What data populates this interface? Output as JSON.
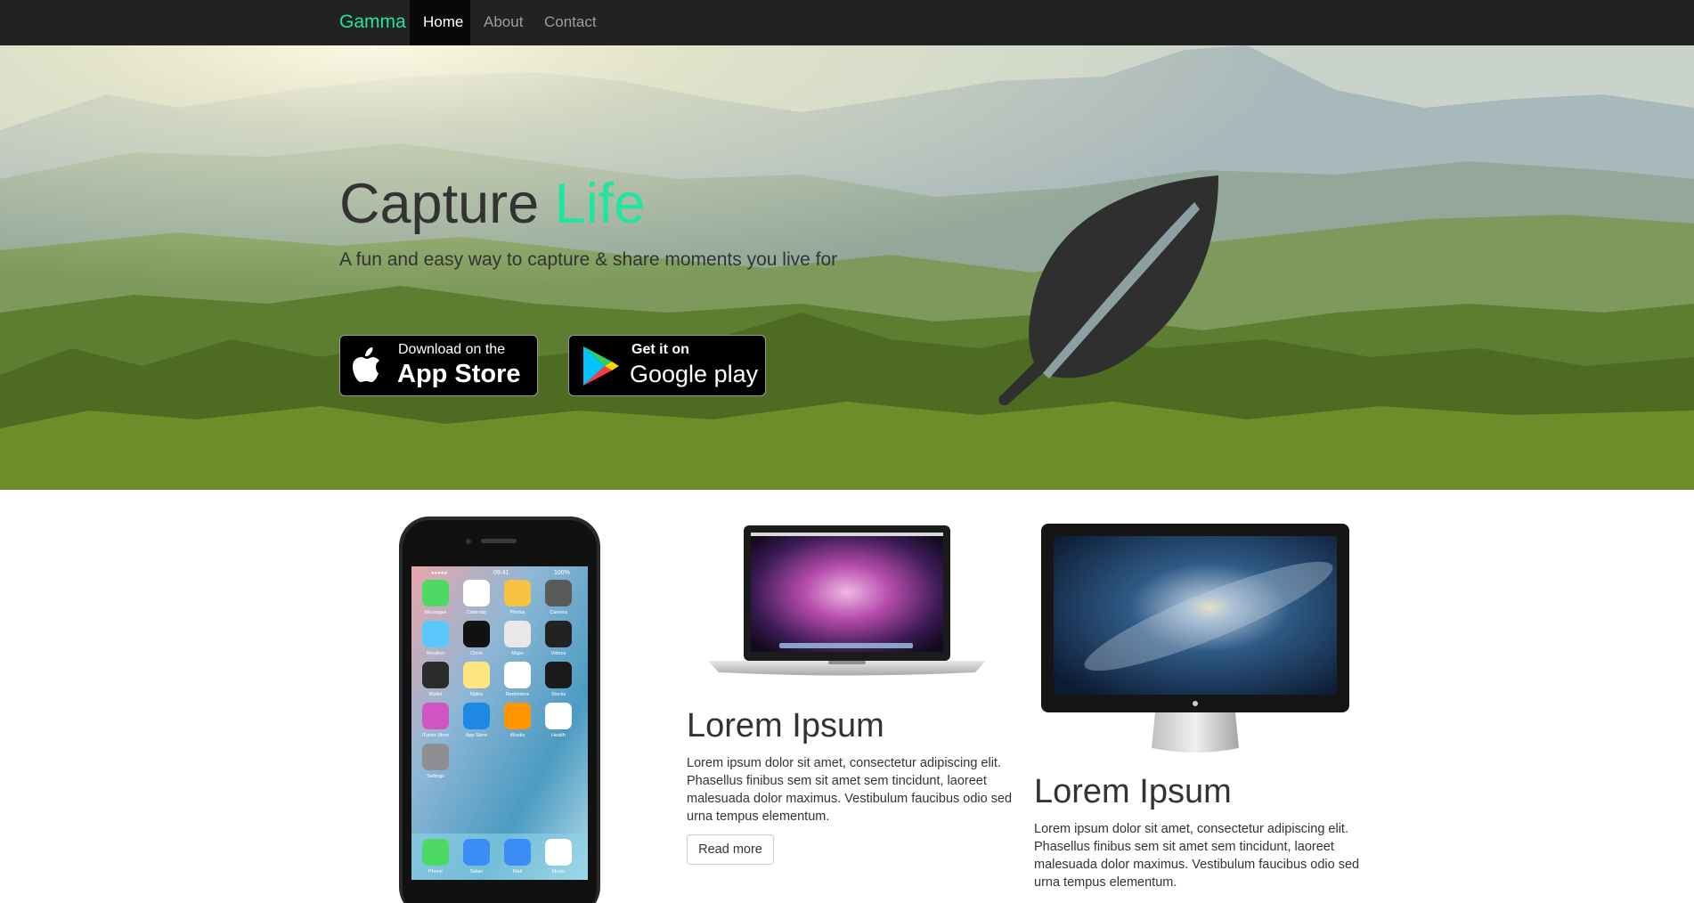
{
  "navbar": {
    "brand": "Gamma",
    "links": [
      {
        "label": "Home",
        "active": true
      },
      {
        "label": "About",
        "active": false
      },
      {
        "label": "Contact",
        "active": false
      }
    ]
  },
  "hero": {
    "title_main": "Capture",
    "title_accent": "Life",
    "subtitle": "A fun and easy way to capture & share moments you live for",
    "app_store": {
      "small": "Download on the",
      "big": "App Store"
    },
    "google_play": {
      "small": "Get it on",
      "big": "Google play"
    },
    "leaf_icon": "leaf-icon"
  },
  "features": [
    {
      "device": "iphone",
      "title": "",
      "text": ""
    },
    {
      "device": "macbook",
      "title": "Lorem Ipsum",
      "text": "Lorem ipsum dolor sit amet, consectetur adipiscing elit. Phasellus finibus sem sit amet sem tincidunt, laoreet malesuada dolor maximus. Vestibulum faucibus odio sed urna tempus elementum.",
      "button": "Read more"
    },
    {
      "device": "imac",
      "title": "Lorem Ipsum",
      "text": "Lorem ipsum dolor sit amet, consectetur adipiscing elit. Phasellus finibus sem sit amet sem tincidunt, laoreet malesuada dolor maximus. Vestibulum faucibus odio sed urna tempus elementum."
    }
  ],
  "phone_screen": {
    "time": "09:41",
    "battery": "100%",
    "apps": [
      "Messages",
      "Calendar",
      "Photos",
      "Camera",
      "Weather",
      "Clock",
      "Maps",
      "Videos",
      "Wallet",
      "Notes",
      "Reminders",
      "Stocks",
      "iTunes Store",
      "App Store",
      "iBooks",
      "Health",
      "Settings"
    ],
    "dock": [
      "Phone",
      "Safari",
      "Mail",
      "Music"
    ]
  },
  "colors": {
    "accent": "#1fe5a2",
    "navbar": "#222222",
    "text": "#333333"
  }
}
